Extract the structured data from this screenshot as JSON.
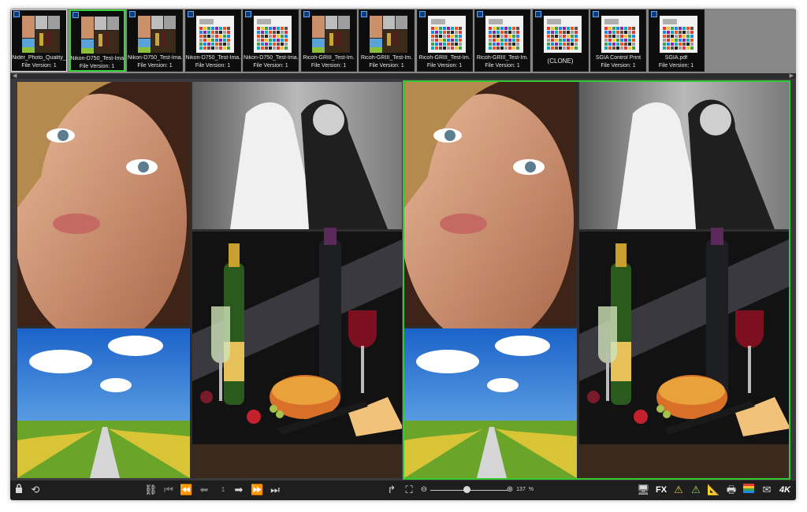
{
  "thumbnails": [
    {
      "name": "Nider_Photo_Quality_",
      "version": "File Version: 1",
      "kind": "photo"
    },
    {
      "name": "Nikon-D750_Test-Ima.",
      "version": "File Version: 1",
      "kind": "photo"
    },
    {
      "name": "Nikon-D750_Test-Ima.",
      "version": "File Version: 1",
      "kind": "photo"
    },
    {
      "name": "Nikon-D750_Test-Ima.",
      "version": "File Version: 1",
      "kind": "chart"
    },
    {
      "name": "Nikon-D750_Test-Ima.",
      "version": "File Version: 1",
      "kind": "chart"
    },
    {
      "name": "Ricoh-GRIII_Test-Im.",
      "version": "File Version: 1",
      "kind": "photo"
    },
    {
      "name": "Ricoh-GRIII_Test-Im.",
      "version": "File Version: 1",
      "kind": "photo"
    },
    {
      "name": "Ricoh-GRIII_Test-Im.",
      "version": "File Version: 1",
      "kind": "chart"
    },
    {
      "name": "Ricoh-GRIII_Test-Im.",
      "version": "File Version: 1",
      "kind": "chart"
    },
    {
      "name": "(CLONE)",
      "version": "",
      "kind": "chart"
    },
    {
      "name": "SGIA Control Print",
      "version": "File Version: 1",
      "kind": "chart"
    },
    {
      "name": "SGIA.pdf",
      "version": "File Version: 1",
      "kind": "chart"
    }
  ],
  "selected_thumbnail_index": 1,
  "toolbar": {
    "page_number": "1",
    "zoom_value": "137",
    "zoom_unit": "%",
    "fx_label": "FX",
    "resolution_label": "4K"
  },
  "icons": {
    "lock": "lock-icon",
    "refresh": "refresh-icon",
    "unlink": "unlink-icon",
    "first": "first-page-icon",
    "rewind": "rewind-icon",
    "prev": "prev-page-icon",
    "next": "next-page-icon",
    "forward": "fast-forward-icon",
    "last": "last-page-icon",
    "redirect": "redirect-arrow-icon",
    "fit": "fit-screen-icon",
    "zoom_out": "zoom-out-icon",
    "zoom_in": "zoom-in-icon",
    "monitor": "monitor-icon",
    "warning1": "warning-icon",
    "warning2": "warning-icon",
    "ruler": "ruler-icon",
    "printer": "printer-icon",
    "colors": "color-bars-icon",
    "mail": "mail-icon"
  },
  "colors": {
    "selection_green": "#36c936",
    "clone_badge_blue": "#5aa9ff"
  }
}
